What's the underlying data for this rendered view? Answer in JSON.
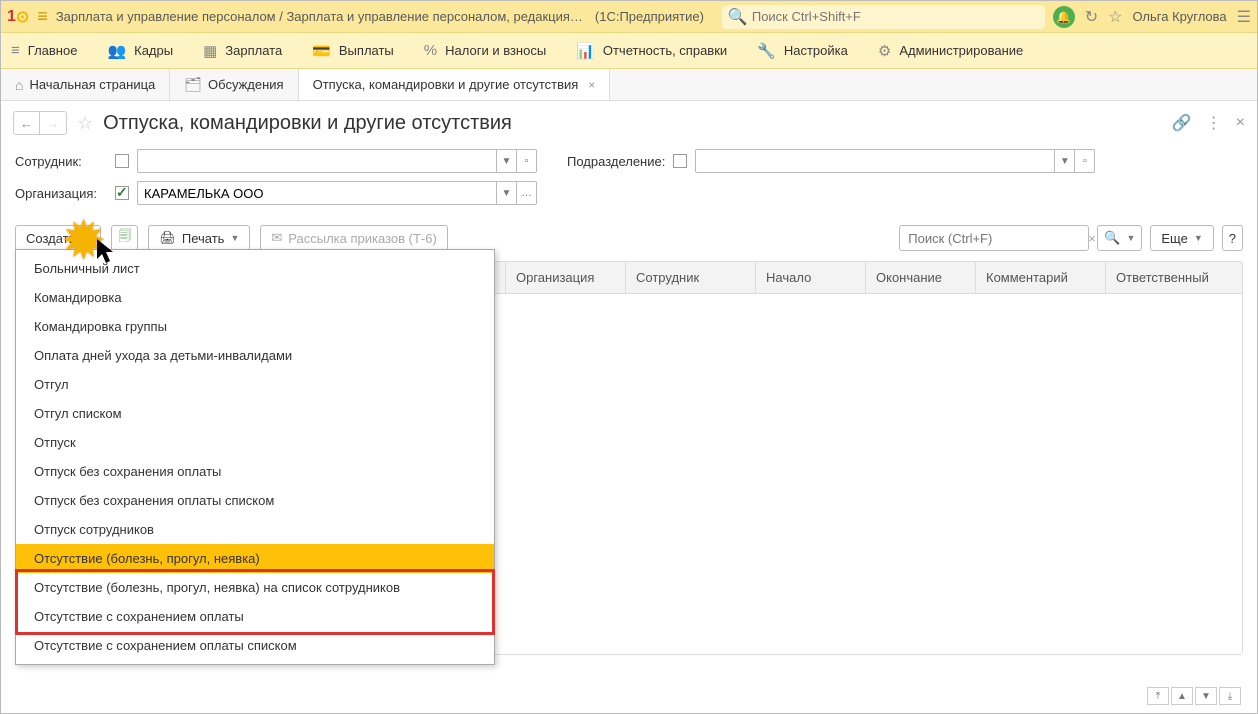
{
  "titlebar": {
    "app_title": "Зарплата и управление персоналом / Зарплата и управление персоналом, редакция…",
    "suffix": "(1С:Предприятие)",
    "search_placeholder": "Поиск Ctrl+Shift+F",
    "username": "Ольга Круглова"
  },
  "nav": {
    "items": [
      {
        "icon": "≡",
        "label": "Главное"
      },
      {
        "icon": "👥",
        "label": "Кадры"
      },
      {
        "icon": "▦",
        "label": "Зарплата"
      },
      {
        "icon": "💳",
        "label": "Выплаты"
      },
      {
        "icon": "%",
        "label": "Налоги и взносы"
      },
      {
        "icon": "📊",
        "label": "Отчетность, справки"
      },
      {
        "icon": "🔧",
        "label": "Настройка"
      },
      {
        "icon": "⚙",
        "label": "Администрирование"
      }
    ]
  },
  "tabs": [
    {
      "icon": "⌂",
      "label": "Начальная страница",
      "closable": false
    },
    {
      "icon": "🗂",
      "label": "Обсуждения",
      "closable": false
    },
    {
      "icon": "",
      "label": "Отпуска, командировки и другие отсутствия",
      "closable": true,
      "active": true
    }
  ],
  "page": {
    "title": "Отпуска, командировки и другие отсутствия"
  },
  "filters": {
    "employee_label": "Сотрудник:",
    "employee_value": "",
    "department_label": "Подразделение:",
    "department_value": "",
    "org_label": "Организация:",
    "org_value": "КАРАМЕЛЬКА ООО"
  },
  "toolbar": {
    "create": "Создать",
    "print": "Печать",
    "mailing": "Рассылка приказов (Т-6)",
    "search_placeholder": "Поиск (Ctrl+F)",
    "more": "Еще",
    "help": "?"
  },
  "dropdown": {
    "items": [
      "Больничный лист",
      "Командировка",
      "Командировка группы",
      "Оплата дней ухода за детьми-инвалидами",
      "Отгул",
      "Отгул списком",
      "Отпуск",
      "Отпуск без сохранения оплаты",
      "Отпуск без сохранения оплаты списком",
      "Отпуск сотрудников",
      "Отсутствие (болезнь, прогул, неявка)",
      "Отсутствие (болезнь, прогул, неявка) на список сотрудников",
      "Отсутствие с сохранением оплаты",
      "Отсутствие с сохранением оплаты списком"
    ],
    "highlighted_index": 10
  },
  "grid": {
    "columns": [
      "Организация",
      "Сотрудник",
      "Начало",
      "Окончание",
      "Комментарий",
      "Ответственный"
    ]
  }
}
